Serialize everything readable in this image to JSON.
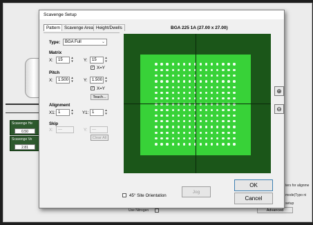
{
  "background": {
    "scavenge_height_label": "Scavenge He",
    "scavenge_height_value": "0.50",
    "scavenge_vel_label": "Scavenge Ve",
    "scavenge_vel_value": "2.81",
    "right_text_1": "ters for alignme",
    "right_text_2": "mode(Typo ni",
    "right_text_3": "setup",
    "use_nitrogen_label": "Use Nitrogen",
    "advanced_label": "Advanced"
  },
  "dialog": {
    "title": "Scavenge Setup",
    "tabs": [
      {
        "label": "Pattern"
      },
      {
        "label": "Scavenge Area"
      },
      {
        "label": "Height/Dwells"
      }
    ],
    "package_name": "BGA 225 1A (27.00 x 27.00)",
    "type": {
      "label": "Type:",
      "value": "BGA Full"
    },
    "matrix": {
      "label": "Matrix",
      "x_label": "X:",
      "x_value": "15",
      "y_label": "Y:",
      "y_value": "15",
      "link_label": "X=Y",
      "link_checked": true
    },
    "pitch": {
      "label": "Pitch",
      "x_label": "X:",
      "x_value": "1.500",
      "y_label": "Y:",
      "y_value": "1.500",
      "link_label": "X=Y",
      "link_checked": true,
      "teach_label": "Teach..."
    },
    "alignment": {
      "label": "Alignment",
      "x_label": "X1:",
      "x_value": "1",
      "y_label": "Y1:",
      "y_value": "1"
    },
    "skip": {
      "label": "Skip",
      "x_label": "X:",
      "x_value": "---",
      "y_label": "Y:",
      "y_value": "---",
      "clear_label": "Clear All"
    },
    "site_orientation_label": "45° Site Orientation",
    "jog_label": "Jog",
    "ok_label": "OK",
    "cancel_label": "Cancel",
    "zoom_in_icon": "zoom-in-icon",
    "zoom_out_icon": "zoom-out-icon"
  },
  "preview": {
    "rows": 15,
    "cols": 15,
    "colors": {
      "frame": "#1b5619",
      "substrate": "#38d238",
      "ball": "#f4fff4",
      "crosshair": "#0a2a0a"
    }
  }
}
